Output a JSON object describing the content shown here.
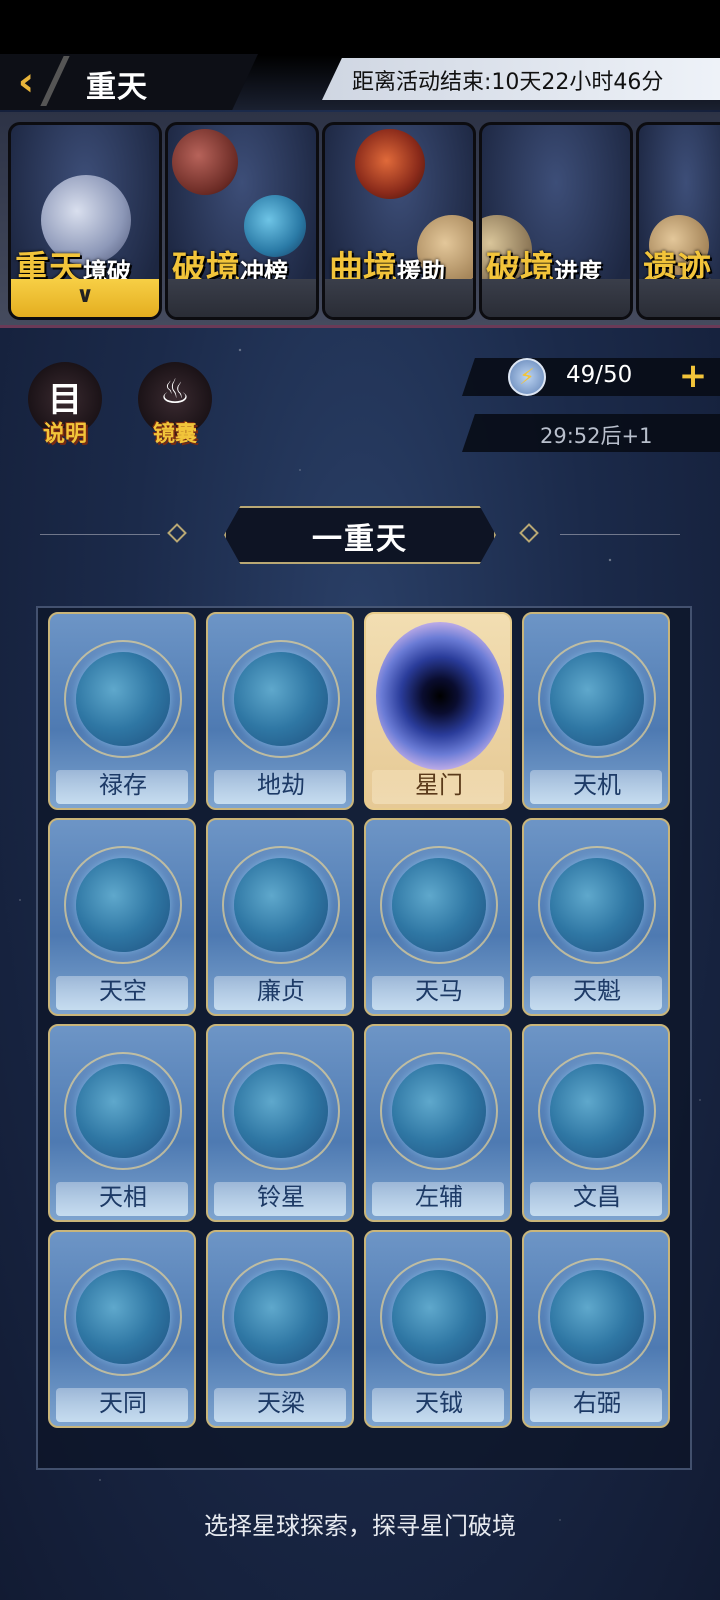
{
  "header": {
    "title": "重天",
    "timer": "距离活动结束:10天22小时46分"
  },
  "tabs": [
    {
      "big": "重天",
      "small": "境破",
      "active": true
    },
    {
      "big": "破境",
      "small": "冲榜",
      "active": false
    },
    {
      "big": "曲境",
      "small": "援助",
      "active": false
    },
    {
      "big": "破境",
      "small": "进度",
      "active": false
    },
    {
      "big": "遗迹",
      "small": "",
      "active": false
    }
  ],
  "side_icons": {
    "info": {
      "glyph": "目",
      "label": "说明"
    },
    "bag": {
      "glyph": "♨",
      "label": "镜囊"
    }
  },
  "energy": {
    "value": "49/50",
    "regen": "29:52后+1"
  },
  "section": {
    "title": "一重天"
  },
  "cards": [
    "禄存",
    "地劫",
    "星门",
    "天机",
    "天空",
    "廉贞",
    "天马",
    "天魁",
    "天相",
    "铃星",
    "左辅",
    "文昌",
    "天同",
    "天梁",
    "天钺",
    "右弼"
  ],
  "hint": "选择星球探索，探寻星门破境",
  "colors": {
    "accent": "#f2c43a",
    "bg": "#1b2a4a"
  }
}
